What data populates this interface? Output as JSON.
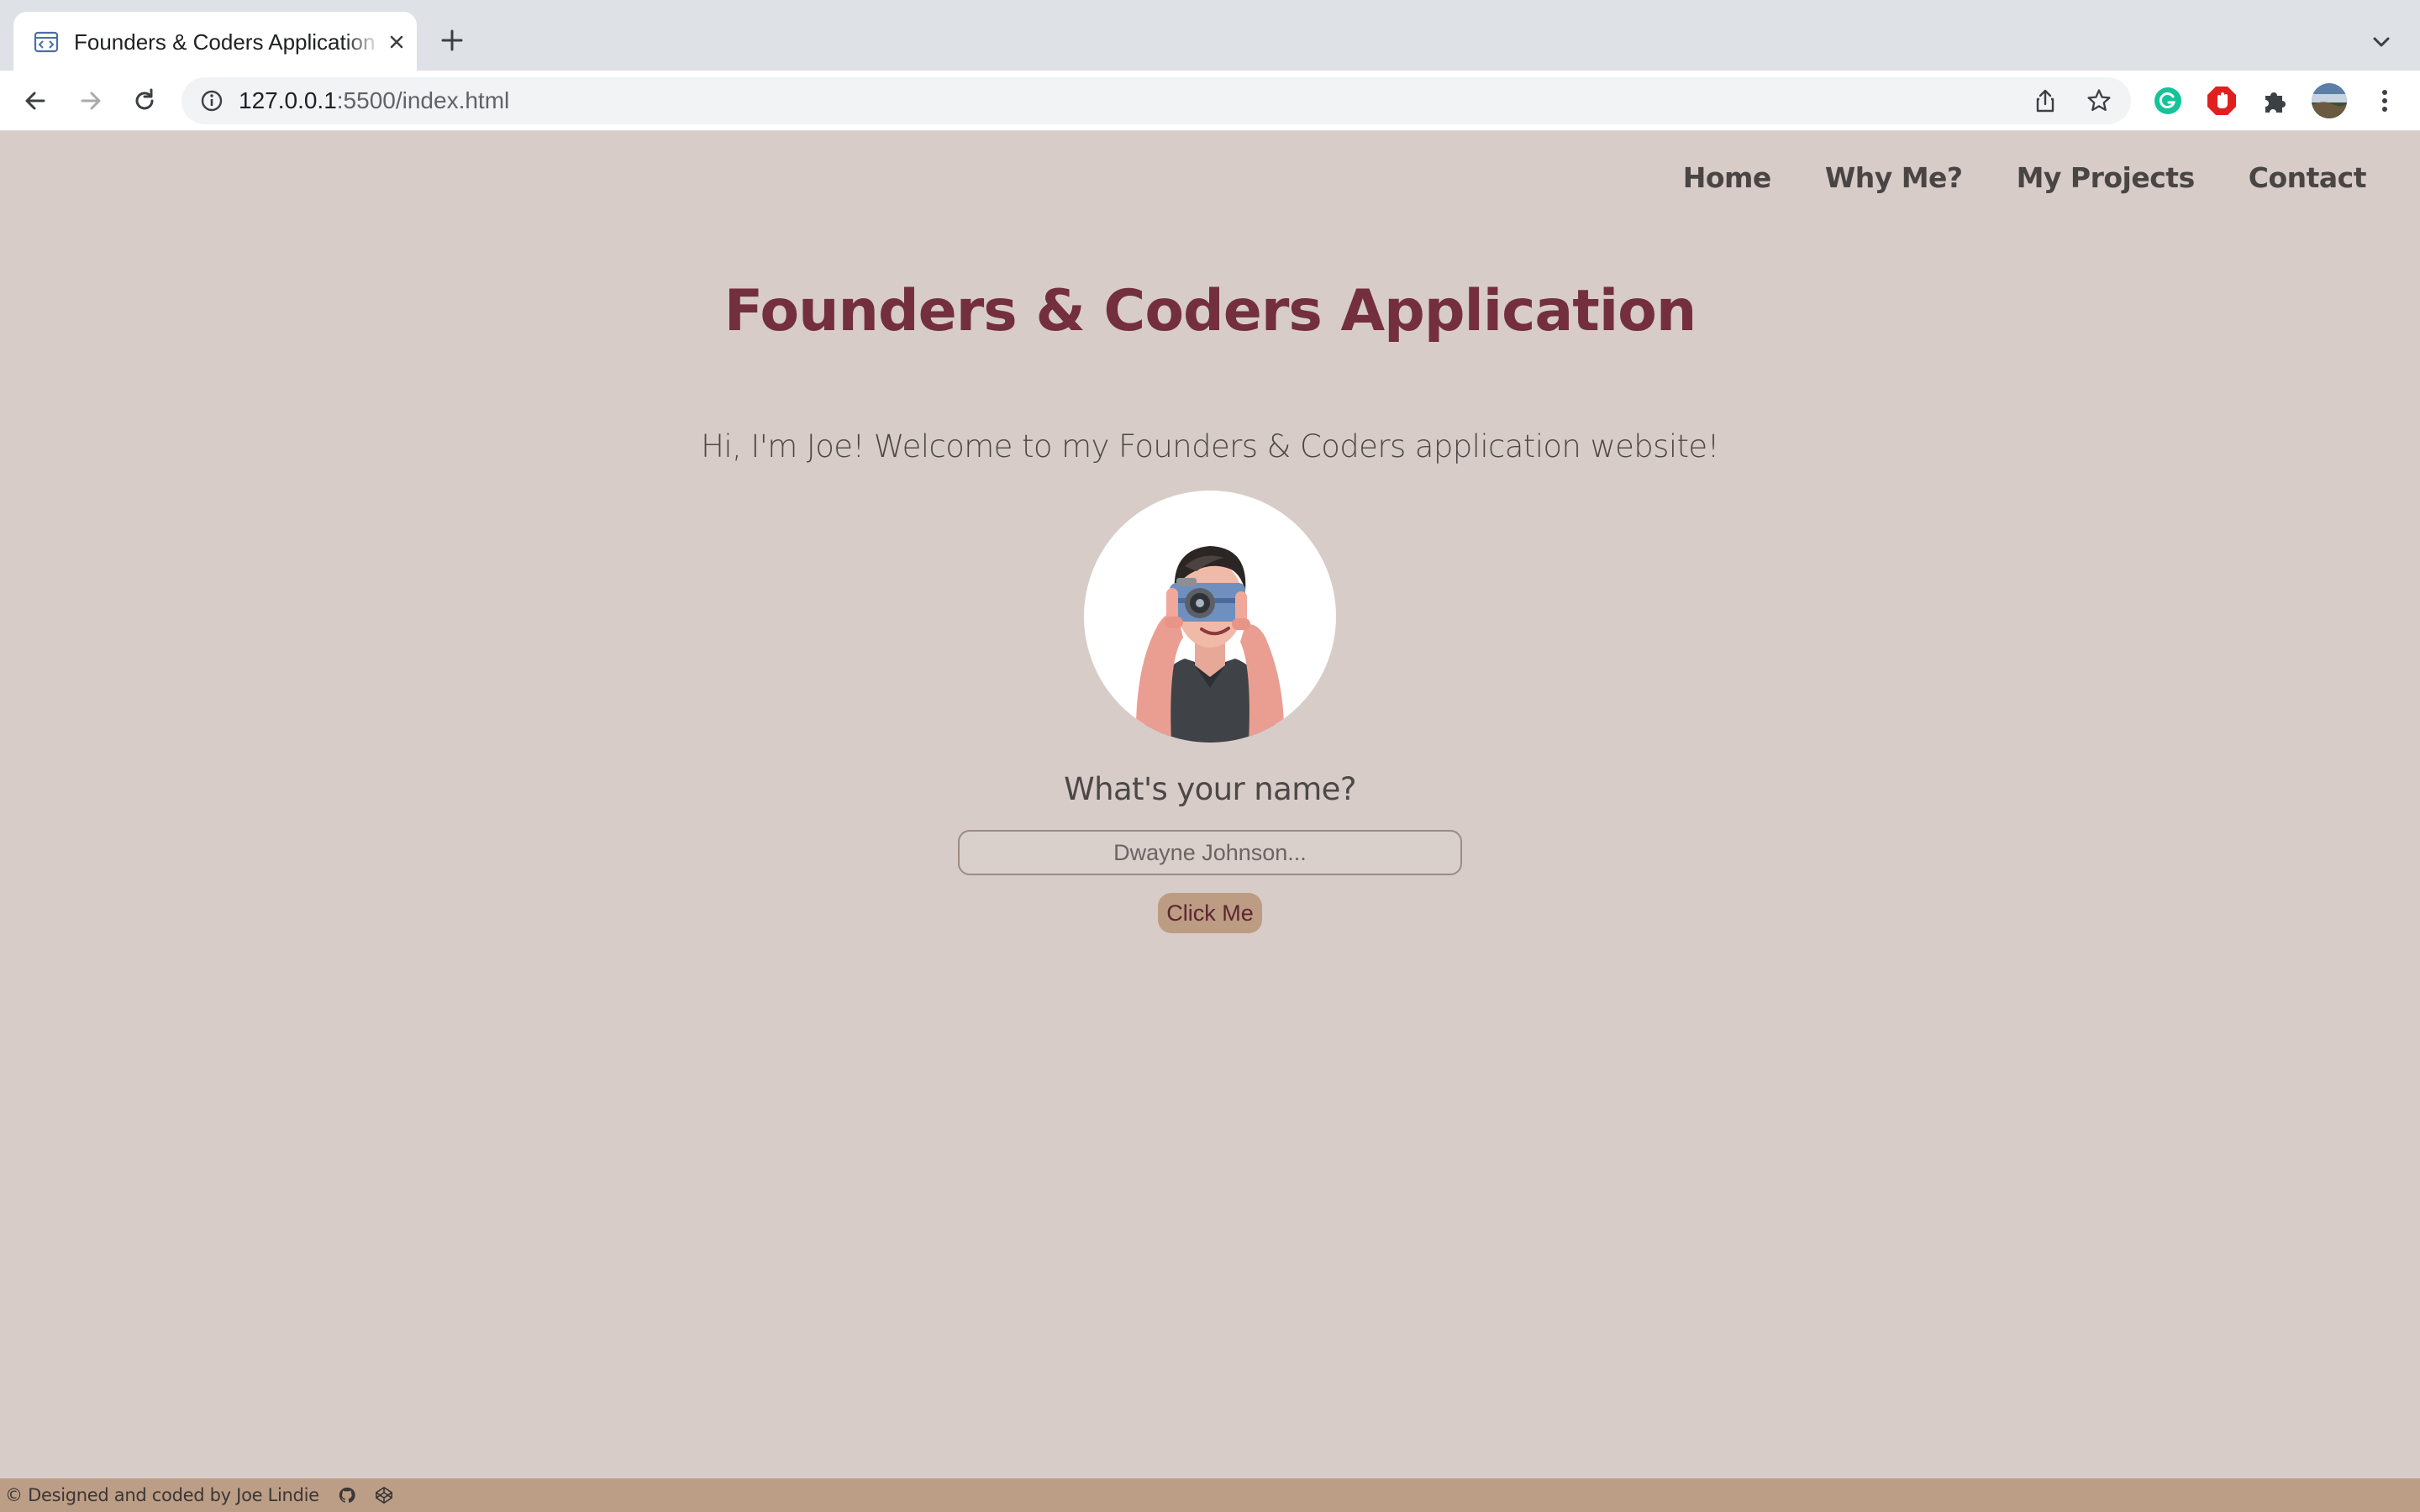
{
  "browser": {
    "tab_title": "Founders & Coders Application",
    "url_host": "127.0.0.1",
    "url_rest": ":5500/index.html",
    "icons": [
      "code-favicon-icon",
      "close-icon",
      "plus-icon",
      "chevron-down-icon",
      "back-arrow-icon",
      "forward-arrow-icon",
      "reload-icon",
      "info-icon",
      "share-icon",
      "star-icon",
      "grammarly-extension-icon",
      "adblock-extension-icon",
      "puzzle-extensions-icon",
      "profile-avatar-icon",
      "kebab-menu-icon"
    ]
  },
  "nav": {
    "items": [
      "Home",
      "Why Me?",
      "My Projects",
      "Contact"
    ]
  },
  "main": {
    "title": "Founders & Coders Application",
    "welcome": "Hi, I'm Joe! Welcome to my Founders & Coders application website!",
    "question": "What's your name?",
    "input_placeholder": "Dwayne Johnson...",
    "button_label": "Click Me"
  },
  "footer": {
    "text": "© Designed and coded by Joe Lindie",
    "icons": [
      "github-icon",
      "codepen-icon"
    ]
  },
  "colors": {
    "page_bg": "#d7ccc7",
    "title": "#732f3e",
    "button_bg": "#bc9c82",
    "footer_bg": "#bc9e86"
  }
}
